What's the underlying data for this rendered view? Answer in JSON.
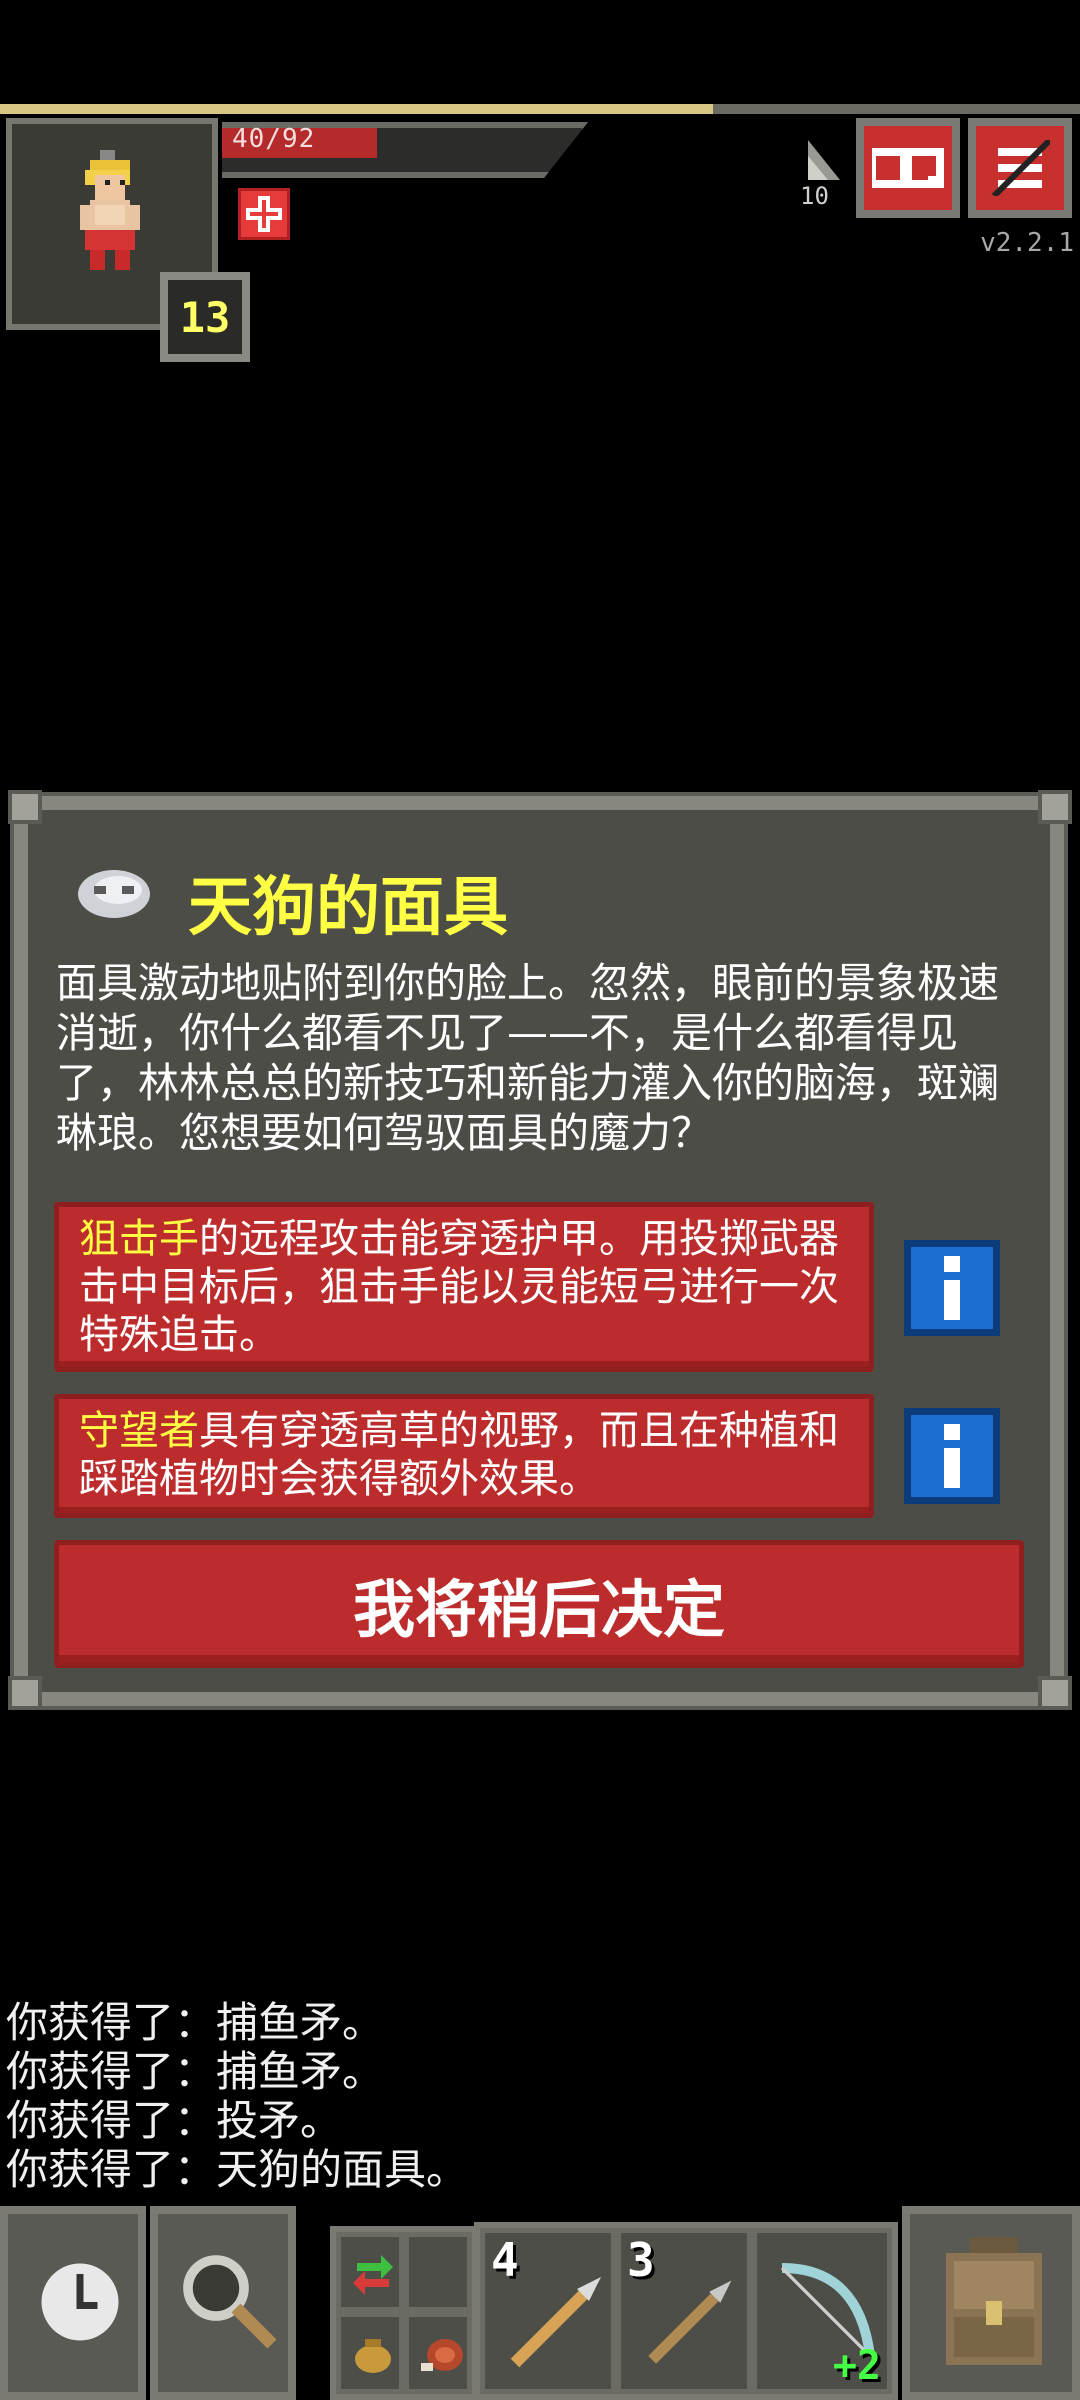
{
  "hud": {
    "hp_text": "40/92",
    "hp_fraction": 0.43,
    "xp_fraction": 0.66,
    "level": "13",
    "depth": "10",
    "version": "v2.2.1",
    "buttons": [
      "journal-icon",
      "menu-icon"
    ]
  },
  "dialog": {
    "title": "天狗的面具",
    "body": "面具激动地贴附到你的脸上。忽然，眼前的景象极速消逝，你什么都看不见了——不，是什么都看得见了，林林总总的新技巧和新能力灌入你的脑海，斑斓琳琅。您想要如何驾驭面具的魔力？",
    "choices": [
      {
        "name": "狙击手",
        "desc": "的远程攻击能穿透护甲。用投掷武器击中目标后，狙击手能以灵能短弓进行一次特殊追击。"
      },
      {
        "name": "守望者",
        "desc": "具有穿透高草的视野，而且在种植和踩踏植物时会获得额外效果。"
      }
    ],
    "later_label": "我将稍后决定"
  },
  "log": [
    "你获得了：捕鱼矛。",
    "你获得了：捕鱼矛。",
    "你获得了：投矛。",
    "你获得了：天狗的面具。"
  ],
  "toolbar": {
    "quickslots": [
      {
        "icon": "spear-icon",
        "count": "4"
      },
      {
        "icon": "spear-icon",
        "count": "3"
      },
      {
        "icon": "bow-icon",
        "badge": "+2"
      }
    ],
    "left_buttons": [
      "wait-icon",
      "search-icon"
    ],
    "right_button": "backpack-icon",
    "mini_slots": [
      "swap-icon",
      "empty-slot",
      "pouch-icon",
      "meat-icon"
    ]
  },
  "colors": {
    "highlight": "#ffff44",
    "button_red": "#bd2c2c",
    "info_blue": "#1a6fd0",
    "panel": "#4d4d48"
  }
}
